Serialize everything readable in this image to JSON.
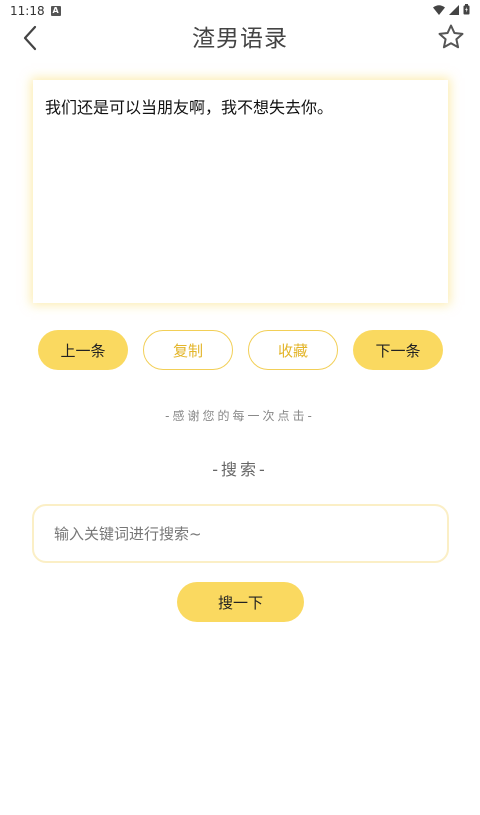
{
  "status_bar": {
    "time": "11:18",
    "badge": "A"
  },
  "header": {
    "title": "渣男语录"
  },
  "quote": {
    "text": "我们还是可以当朋友啊，我不想失去你。"
  },
  "actions": {
    "prev_label": "上一条",
    "copy_label": "复制",
    "favorite_label": "收藏",
    "next_label": "下一条"
  },
  "thanks_text": "-感谢您的每一次点击-",
  "search": {
    "heading": "-搜索-",
    "placeholder": "输入关键词进行搜索~",
    "value": "",
    "button_label": "搜一下"
  },
  "colors": {
    "accent": "#fad960",
    "accent_text": "#e3b52a",
    "card_glow": "#fadc6e"
  },
  "icons": {
    "back": "chevron-left-icon",
    "favorite": "star-outline-icon",
    "wifi": "wifi-icon",
    "signal": "signal-icon",
    "battery": "battery-icon"
  }
}
